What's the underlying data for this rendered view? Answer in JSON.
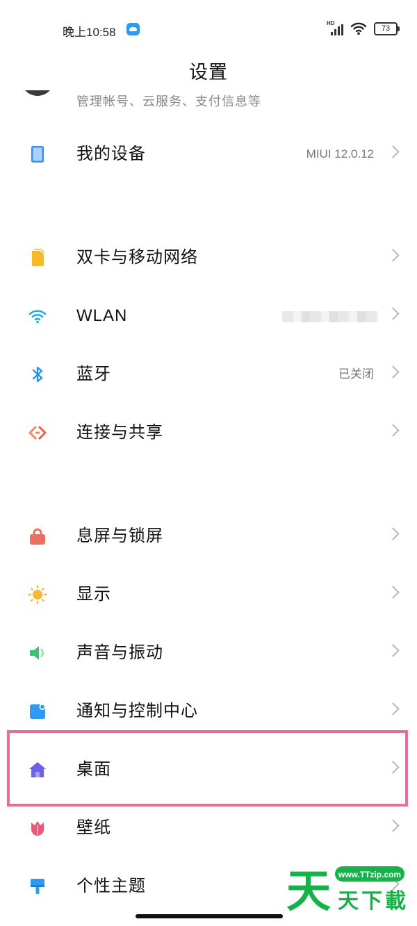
{
  "status_bar": {
    "time": "晚上10:58",
    "signal_label": "HD",
    "battery": "73"
  },
  "page": {
    "title": "设置"
  },
  "account": {
    "subtitle": "管理帐号、云服务、支付信息等"
  },
  "rows": [
    {
      "label": "我的设备",
      "value": "MIUI 12.0.12",
      "icon": "tablet-icon"
    },
    {
      "label": "双卡与移动网络",
      "value": "",
      "icon": "sim-card-icon"
    },
    {
      "label": "WLAN",
      "value": "",
      "icon": "wifi-icon"
    },
    {
      "label": "蓝牙",
      "value": "已关闭",
      "icon": "bluetooth-icon"
    },
    {
      "label": "连接与共享",
      "value": "",
      "icon": "connection-share-icon"
    },
    {
      "label": "息屏与锁屏",
      "value": "",
      "icon": "lock-icon"
    },
    {
      "label": "显示",
      "value": "",
      "icon": "sun-icon"
    },
    {
      "label": "声音与振动",
      "value": "",
      "icon": "speaker-icon"
    },
    {
      "label": "通知与控制中心",
      "value": "",
      "icon": "notification-icon"
    },
    {
      "label": "桌面",
      "value": "",
      "icon": "home-icon"
    },
    {
      "label": "壁纸",
      "value": "",
      "icon": "tulip-icon"
    },
    {
      "label": "个性主题",
      "value": "",
      "icon": "paint-brush-icon"
    }
  ],
  "watermark": {
    "url": "www.TTzip.com",
    "logo_char": "天",
    "text": "天下載"
  },
  "colors": {
    "highlight": "#ea6d98",
    "accent_blue": "#2f9bf0",
    "watermark_green": "#15b24a"
  }
}
